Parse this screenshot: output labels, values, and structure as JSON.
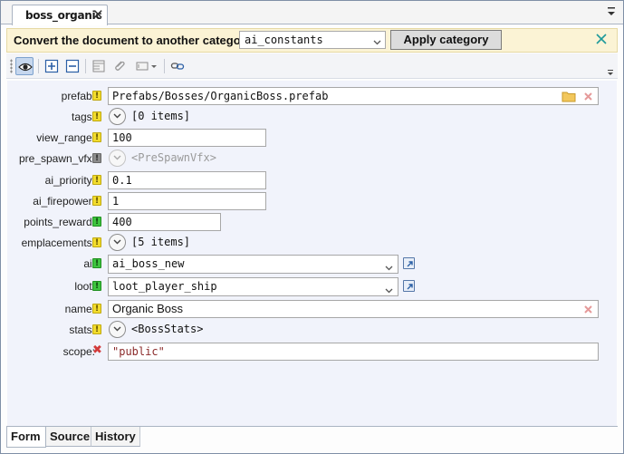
{
  "tab": {
    "title": "boss_organic"
  },
  "convert_bar": {
    "message": "Convert the document to another category:",
    "category_value": "ai_constants",
    "apply_label": "Apply category"
  },
  "fields": {
    "prefab": {
      "label": "prefab:",
      "status": "warning",
      "value": "Prefabs/Bosses/OrganicBoss.prefab"
    },
    "tags": {
      "label": "tags:",
      "status": "warning",
      "value": "[0 items]"
    },
    "view_range": {
      "label": "view_range:",
      "status": "warning",
      "value": "100"
    },
    "pre_spawn_vfx": {
      "label": "pre_spawn_vfx:",
      "status": "disabled",
      "value": "<PreSpawnVfx>"
    },
    "ai_priority": {
      "label": "ai_priority:",
      "status": "warning",
      "value": "0.1"
    },
    "ai_firepower": {
      "label": "ai_firepower:",
      "status": "warning",
      "value": "1"
    },
    "points_reward": {
      "label": "points_reward:",
      "status": "ok",
      "value": "400"
    },
    "emplacements": {
      "label": "emplacements:",
      "status": "warning",
      "value": "[5 items]"
    },
    "ai": {
      "label": "ai:",
      "status": "ok",
      "value": "ai_boss_new"
    },
    "loot": {
      "label": "loot:",
      "status": "ok",
      "value": "loot_player_ship"
    },
    "name": {
      "label": "name:",
      "status": "warning",
      "value": "Organic Boss"
    },
    "stats": {
      "label": "stats:",
      "status": "warning",
      "value": "<BossStats>"
    },
    "scope": {
      "label": "scope:",
      "status": "error",
      "value": "\"public\""
    }
  },
  "bottom_tabs": [
    "Form",
    "Source",
    "History"
  ],
  "icons": {
    "status_warning": "!",
    "status_ok": "!",
    "status_disabled": "!",
    "status_error": "✖"
  },
  "colors": {
    "warning": "#f2dc2d",
    "ok": "#3ec43e",
    "error": "#d23b3b",
    "string_value": "#8b2b2b",
    "convert_bar_bg": "#fbf3d5",
    "form_bg": "#f1f3fb"
  }
}
